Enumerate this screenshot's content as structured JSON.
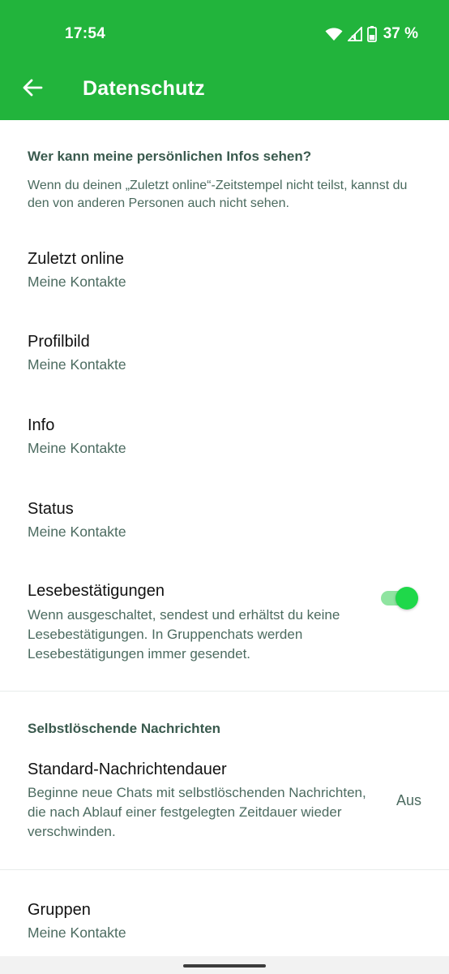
{
  "status_bar": {
    "time": "17:54",
    "battery": "37 %"
  },
  "header": {
    "title": "Datenschutz"
  },
  "sections": {
    "personal": {
      "header": "Wer kann meine persönlichen Infos sehen?",
      "desc": "Wenn du deinen „Zuletzt online“-Zeitstempel nicht teilst, kannst du den von anderen Personen auch nicht sehen."
    },
    "disappearing": {
      "header": "Selbstlöschende Nachrichten"
    }
  },
  "items": {
    "last_seen": {
      "title": "Zuletzt online",
      "value": "Meine Kontakte"
    },
    "profile_photo": {
      "title": "Profilbild",
      "value": "Meine Kontakte"
    },
    "about": {
      "title": "Info",
      "value": "Meine Kontakte"
    },
    "status": {
      "title": "Status",
      "value": "Meine Kontakte"
    },
    "read_receipts": {
      "title": "Lesebestätigungen",
      "desc": "Wenn ausgeschaltet, sendest und erhältst du keine Lesebestätigungen. In Gruppenchats werden Lesebestätigungen immer gesendet.",
      "enabled": true
    },
    "default_timer": {
      "title": "Standard-Nachrichtendauer",
      "desc": "Beginne neue Chats mit selbstlöschenden Nachrichten, die nach Ablauf einer festgelegten Zeitdauer wieder verschwinden.",
      "value": "Aus"
    },
    "groups": {
      "title": "Gruppen",
      "value": "Meine Kontakte"
    }
  },
  "colors": {
    "app_bar": "#22b43c",
    "toggle_on": "#1fd84a",
    "secondary_text": "#4c6b60"
  },
  "icons": {
    "back": "arrow-left-icon",
    "wifi": "wifi-icon",
    "signal": "signal-icon",
    "battery": "battery-icon"
  }
}
